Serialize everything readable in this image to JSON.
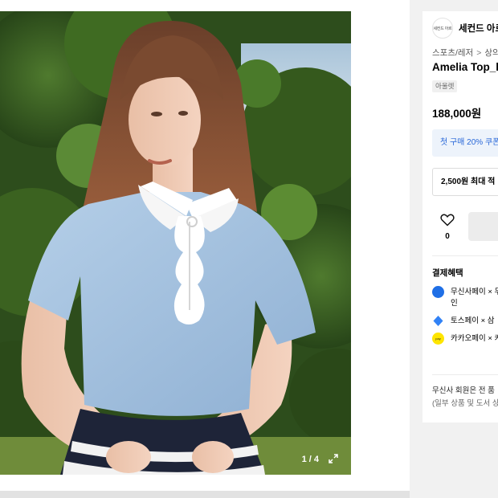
{
  "gallery": {
    "counter": "1 / 4",
    "expand_icon": "expand-icon"
  },
  "product": {
    "brand_logo_text": "세컨드 아르",
    "brand_name": "세컨드 아르",
    "breadcrumb": [
      "스포츠/레저",
      "상의"
    ],
    "title": "Amelia Top_l",
    "tag": "아울렛",
    "price": "188,000원",
    "coupon": "첫 구매 20% 쿠폰",
    "points": "2,500원 최대 적",
    "like": {
      "icon": "heart-icon",
      "count": "0"
    }
  },
  "benefits": {
    "heading": "결제혜택",
    "items": [
      {
        "label": "무신사페이 × 무",
        "line2": "인",
        "color": "#1f6fe6"
      },
      {
        "label": "토스페이 × 삼",
        "color": "#3182f6"
      },
      {
        "label": "카카오페이 × 카",
        "color": "#fee500"
      }
    ]
  },
  "membership": {
    "line1": "무신사 회원은 전 품",
    "line2": "(일부 상품 및 도서 상"
  }
}
